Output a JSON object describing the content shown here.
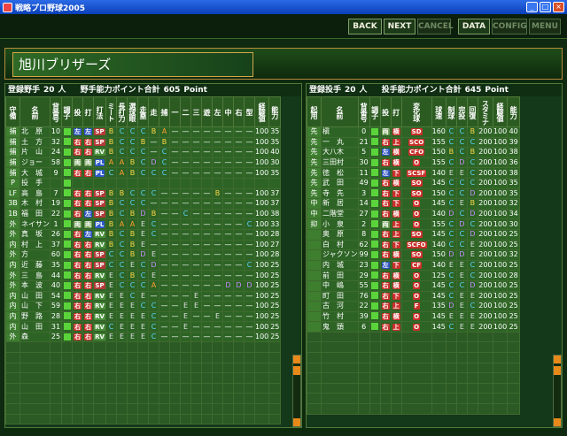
{
  "window": {
    "title": "戦略プロ野球2005"
  },
  "toolbar": {
    "back": "BACK",
    "next": "NEXT",
    "cancel": "CANCEL",
    "data": "DATA",
    "config": "CONFIG",
    "menu": "MENU"
  },
  "team": {
    "name": "旭川ブリザーズ"
  },
  "batters": {
    "label": "登録野手",
    "count": "20",
    "unit": "人",
    "points_label": "野手能力ポイント合計",
    "points": "605",
    "points_unit": "Point",
    "headers": [
      "守備",
      "名前",
      "背番号",
      "調子",
      "投",
      "打",
      "打法",
      "ミート",
      "長打力",
      "選球眼",
      "走塁",
      "走",
      "捕",
      "一",
      "二",
      "三",
      "遊",
      "左",
      "中",
      "右",
      "型",
      "経験値",
      "能力"
    ],
    "rows": [
      [
        "捕",
        "北　原",
        "10",
        "",
        "左",
        "左",
        "SP",
        "B",
        "C",
        "C",
        "C",
        "B",
        "A",
        "—",
        "—",
        "—",
        "—",
        "—",
        "—",
        "—",
        "—",
        "100",
        "35"
      ],
      [
        "捕",
        "土　方",
        "32",
        "",
        "右",
        "右",
        "SP",
        "B",
        "C",
        "C",
        "B",
        "—",
        "B",
        "—",
        "—",
        "—",
        "—",
        "—",
        "—",
        "—",
        "—",
        "100",
        "35"
      ],
      [
        "捕",
        "片　山",
        "24",
        "",
        "右",
        "右",
        "RV",
        "B",
        "C",
        "C",
        "C",
        "—",
        "C",
        "—",
        "—",
        "—",
        "—",
        "—",
        "—",
        "—",
        "—",
        "100",
        "40"
      ],
      [
        "捕",
        "ジョー",
        "58",
        "",
        "両",
        "両",
        "PL",
        "A",
        "A",
        "B",
        "C",
        "D",
        "C",
        "—",
        "—",
        "—",
        "—",
        "—",
        "—",
        "—",
        "—",
        "100",
        "30"
      ],
      [
        "捕",
        "大　城",
        "9",
        "",
        "右",
        "右",
        "PL",
        "C",
        "A",
        "B",
        "C",
        "C",
        "C",
        "—",
        "—",
        "—",
        "—",
        "—",
        "—",
        "—",
        "—",
        "100",
        "35"
      ],
      [
        "P",
        "投　手",
        "",
        "",
        "",
        "",
        "",
        "",
        "",
        "",
        "",
        "",
        "",
        "",
        "",
        "",
        "",
        "",
        "",
        "",
        "",
        "",
        ""
      ],
      [
        "LF",
        "高　島",
        "7",
        "",
        "右",
        "右",
        "SP",
        "B",
        "B",
        "C",
        "C",
        "C",
        "—",
        "—",
        "—",
        "—",
        "—",
        "B",
        "—",
        "—",
        "—",
        "100",
        "37"
      ],
      [
        "3B",
        "木　村",
        "19",
        "",
        "右",
        "右",
        "SP",
        "B",
        "C",
        "C",
        "C",
        "—",
        "—",
        "—",
        "—",
        "—",
        "—",
        "—",
        "—",
        "—",
        "—",
        "100",
        "37"
      ],
      [
        "1B",
        "福　田",
        "22",
        "",
        "右",
        "左",
        "SP",
        "B",
        "C",
        "B",
        "D",
        "B",
        "—",
        "—",
        "C",
        "—",
        "—",
        "—",
        "—",
        "—",
        "—",
        "100",
        "38"
      ],
      [
        "外",
        "ネイサン",
        "1",
        "",
        "両",
        "両",
        "PL",
        "B",
        "A",
        "A",
        "E",
        "C",
        "—",
        "—",
        "—",
        "—",
        "—",
        "—",
        "—",
        "—",
        "C",
        "100",
        "33"
      ],
      [
        "外",
        "真　坂",
        "26",
        "",
        "右",
        "左",
        "RV",
        "B",
        "C",
        "B",
        "E",
        "C",
        "—",
        "—",
        "—",
        "—",
        "—",
        "—",
        "—",
        "—",
        "—",
        "100",
        "28"
      ],
      [
        "内",
        "村　上",
        "37",
        "",
        "右",
        "右",
        "RV",
        "B",
        "C",
        "B",
        "E",
        "—",
        "—",
        "—",
        "—",
        "—",
        "—",
        "—",
        "—",
        "—",
        "—",
        "100",
        "27"
      ],
      [
        "外",
        "方",
        "60",
        "",
        "右",
        "右",
        "SP",
        "C",
        "C",
        "B",
        "D",
        "E",
        "—",
        "—",
        "—",
        "—",
        "—",
        "—",
        "—",
        "—",
        "—",
        "100",
        "28"
      ],
      [
        "内",
        "近　藤",
        "35",
        "",
        "右",
        "右",
        "SP",
        "C",
        "C",
        "E",
        "C",
        "D",
        "—",
        "—",
        "—",
        "—",
        "—",
        "—",
        "—",
        "—",
        "C",
        "100",
        "25"
      ],
      [
        "外",
        "三　島",
        "44",
        "",
        "右",
        "右",
        "RV",
        "E",
        "C",
        "B",
        "C",
        "E",
        "—",
        "—",
        "—",
        "—",
        "—",
        "—",
        "—",
        "—",
        "—",
        "100",
        "25"
      ],
      [
        "外",
        "本　波",
        "40",
        "",
        "右",
        "右",
        "SP",
        "E",
        "C",
        "C",
        "C",
        "A",
        "—",
        "—",
        "—",
        "—",
        "—",
        "—",
        "D",
        "D",
        "D",
        "100",
        "25"
      ],
      [
        "内",
        "山　田",
        "54",
        "",
        "右",
        "右",
        "RV",
        "E",
        "E",
        "C",
        "E",
        "—",
        "—",
        "—",
        "—",
        "E",
        "—",
        "—",
        "—",
        "—",
        "—",
        "100",
        "25"
      ],
      [
        "内",
        "山　下",
        "59",
        "",
        "右",
        "右",
        "RV",
        "E",
        "E",
        "E",
        "C",
        "C",
        "—",
        "—",
        "E",
        "E",
        "—",
        "—",
        "—",
        "—",
        "—",
        "100",
        "25"
      ],
      [
        "内",
        "野　路",
        "28",
        "",
        "右",
        "右",
        "RV",
        "E",
        "E",
        "E",
        "E",
        "C",
        "—",
        "—",
        "E",
        "—",
        "—",
        "E",
        "—",
        "—",
        "—",
        "100",
        "25"
      ],
      [
        "内",
        "山　田",
        "31",
        "",
        "右",
        "右",
        "RV",
        "C",
        "E",
        "E",
        "E",
        "C",
        "—",
        "—",
        "E",
        "—",
        "—",
        "—",
        "—",
        "—",
        "—",
        "100",
        "25"
      ],
      [
        "外",
        "森",
        "25",
        "",
        "右",
        "右",
        "RV",
        "E",
        "E",
        "E",
        "E",
        "C",
        "—",
        "—",
        "—",
        "—",
        "—",
        "—",
        "—",
        "—",
        "—",
        "100",
        "25"
      ]
    ]
  },
  "pitchers": {
    "label": "登録投手",
    "count": "20",
    "unit": "人",
    "points_label": "投手能力ポイント合計",
    "points": "645",
    "points_unit": "Point",
    "headers": [
      "起用",
      "名前",
      "背番号",
      "調子",
      "投",
      "打",
      "変化球",
      "球速",
      "制球",
      "完投",
      "回復",
      "スタミナ",
      "経験値",
      "能力"
    ],
    "rows": [
      [
        "先",
        "槇",
        "0",
        "",
        "両",
        "横",
        "SD",
        "160",
        "C",
        "C",
        "B",
        "200",
        "100",
        "40"
      ],
      [
        "先",
        "一　丸",
        "21",
        "",
        "右",
        "上",
        "SCO",
        "155",
        "C",
        "C",
        "C",
        "200",
        "100",
        "39"
      ],
      [
        "先",
        "大八木",
        "5",
        "",
        "左",
        "横",
        "CFO",
        "150",
        "B",
        "C",
        "B",
        "200",
        "100",
        "38"
      ],
      [
        "先",
        "三田村",
        "30",
        "",
        "右",
        "横",
        "O",
        "155",
        "C",
        "D",
        "C",
        "200",
        "100",
        "36"
      ],
      [
        "先",
        "徳　松",
        "11",
        "",
        "左",
        "下",
        "SCSF",
        "140",
        "E",
        "E",
        "C",
        "200",
        "100",
        "38"
      ],
      [
        "先",
        "武　田",
        "49",
        "",
        "右",
        "横",
        "SO",
        "145",
        "C",
        "C",
        "C",
        "200",
        "100",
        "35"
      ],
      [
        "先",
        "寺　先",
        "3",
        "",
        "右",
        "下",
        "SO",
        "150",
        "C",
        "C",
        "D",
        "200",
        "100",
        "35"
      ],
      [
        "中",
        "新　居",
        "14",
        "",
        "右",
        "下",
        "O",
        "145",
        "C",
        "E",
        "B",
        "200",
        "100",
        "32"
      ],
      [
        "中",
        "二階堂",
        "27",
        "",
        "右",
        "横",
        "O",
        "140",
        "D",
        "C",
        "D",
        "200",
        "100",
        "34"
      ],
      [
        "抑",
        "小　泉",
        "2",
        "",
        "両",
        "上",
        "O",
        "155",
        "C",
        "D",
        "C",
        "200",
        "100",
        "30"
      ],
      [
        "",
        "奥　原",
        "8",
        "",
        "右",
        "上",
        "SO",
        "145",
        "C",
        "C",
        "D",
        "200",
        "100",
        "25"
      ],
      [
        "",
        "白　村",
        "62",
        "",
        "右",
        "下",
        "SCFO",
        "140",
        "C",
        "C",
        "E",
        "200",
        "100",
        "25"
      ],
      [
        "",
        "ジャクソン",
        "99",
        "",
        "右",
        "横",
        "SO",
        "150",
        "D",
        "D",
        "E",
        "200",
        "100",
        "32"
      ],
      [
        "",
        "内　城",
        "23",
        "",
        "左",
        "下",
        "CF",
        "140",
        "E",
        "E",
        "C",
        "200",
        "100",
        "25"
      ],
      [
        "",
        "前　田",
        "29",
        "",
        "右",
        "横",
        "O",
        "125",
        "C",
        "E",
        "C",
        "200",
        "100",
        "28"
      ],
      [
        "",
        "中　嶋",
        "55",
        "",
        "右",
        "横",
        "O",
        "145",
        "C",
        "C",
        "D",
        "200",
        "100",
        "25"
      ],
      [
        "",
        "町　田",
        "76",
        "",
        "右",
        "下",
        "O",
        "145",
        "C",
        "E",
        "E",
        "200",
        "100",
        "25"
      ],
      [
        "",
        "古　河",
        "22",
        "",
        "右",
        "上",
        "F",
        "135",
        "D",
        "E",
        "C",
        "200",
        "100",
        "25"
      ],
      [
        "",
        "竹　村",
        "39",
        "",
        "右",
        "横",
        "O",
        "145",
        "E",
        "E",
        "E",
        "200",
        "100",
        "25"
      ],
      [
        "",
        "鬼　頭",
        "6",
        "",
        "右",
        "上",
        "O",
        "145",
        "C",
        "E",
        "E",
        "200",
        "100",
        "25"
      ]
    ]
  }
}
